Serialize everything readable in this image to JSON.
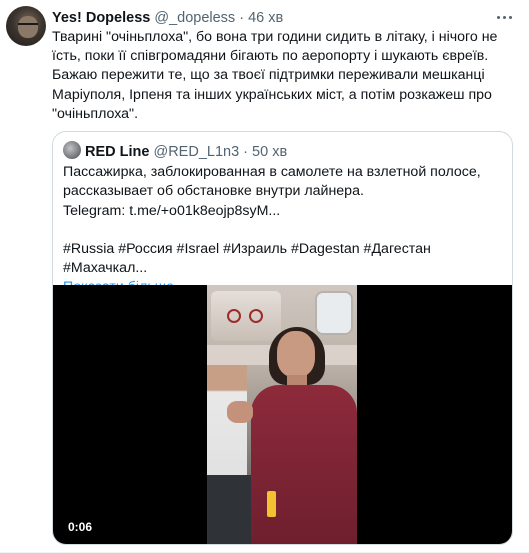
{
  "tweet": {
    "author_name": "Yes! Dopeless",
    "author_handle": "@_dopeless",
    "separator": "·",
    "time": "46 хв",
    "paragraphs": [
      "Тварині \"очіньплоха\", бо вона три години сидить в літаку, і нічого не їсть, поки її співгромадяни бігають по аеропорту і шукають євреїв.",
      "Бажаю пережити те, що за твоєї підтримки переживали мешканці Маріуполя, Ірпеня та інших українських міст, а потім розкажеш про \"очіньплоха\"."
    ],
    "more_icon": "more-horizontal-icon"
  },
  "quote": {
    "author_name": "RED Line",
    "author_handle": "@RED_L1n3",
    "separator": "·",
    "time": "50 хв",
    "lines": [
      "Пассажирка, заблокированная в самолете на взлетной полосе,",
      "рассказывает об обстановке внутри лайнера.",
      "Telegram: t.me/+o01k8eojp8syM..."
    ],
    "hashtags": "#Russia #Россия #Israel #Израиль #Dagestan #Дагестан #Махачкал...",
    "show_more": "Показати більше",
    "video": {
      "timestamp": "0:06"
    }
  },
  "colors": {
    "text": "#0f1419",
    "secondary": "#536471",
    "link": "#1d9bf0",
    "border": "#cfd9de"
  }
}
